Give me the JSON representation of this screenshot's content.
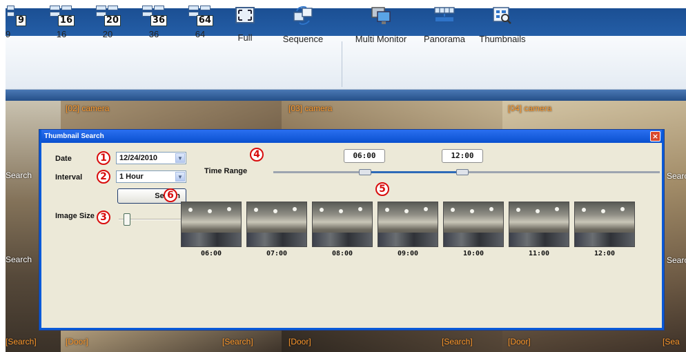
{
  "toolbar": {
    "buttons": [
      {
        "label": "9",
        "num": "9"
      },
      {
        "label": "16",
        "num": "16"
      },
      {
        "label": "20",
        "num": "20"
      },
      {
        "label": "36",
        "num": "36"
      },
      {
        "label": "64",
        "num": "64"
      },
      {
        "label": "Full"
      },
      {
        "label": "Sequence"
      },
      {
        "label": "Multi Monitor"
      },
      {
        "label": "Panorama"
      },
      {
        "label": "Thumbnails"
      }
    ]
  },
  "cameras": {
    "b_label": "[02] camera",
    "c_label": "[03] camera",
    "d_label": "[04] camera",
    "side_label": "Search",
    "bottom_labels": [
      "[Search]",
      "[Door]",
      "[Search]",
      "[Door]",
      "[Search]",
      "[Door]",
      "[Sea"
    ]
  },
  "dialog": {
    "title": "Thumbnail Search",
    "close_glyph": "×",
    "date_label": "Date",
    "date_value": "12/24/2010",
    "interval_label": "Interval",
    "interval_value": "1 Hour",
    "search_button": "Search",
    "image_size_label": "Image Size",
    "time_range_label": "Time Range",
    "range_start": "06:00",
    "range_end": "12:00",
    "image_size_level": 0.08,
    "markers": [
      "1",
      "2",
      "3",
      "4",
      "5",
      "6"
    ],
    "thumbnails": [
      {
        "time": "06:00"
      },
      {
        "time": "07:00"
      },
      {
        "time": "08:00"
      },
      {
        "time": "09:00"
      },
      {
        "time": "10:00"
      },
      {
        "time": "11:00"
      },
      {
        "time": "12:00"
      }
    ]
  },
  "colors": {
    "title_bar": "#1b4f93",
    "dialog_border": "#0a5ad8",
    "marker_red": "#d80c0c",
    "camera_label": "#ff9a2e"
  }
}
